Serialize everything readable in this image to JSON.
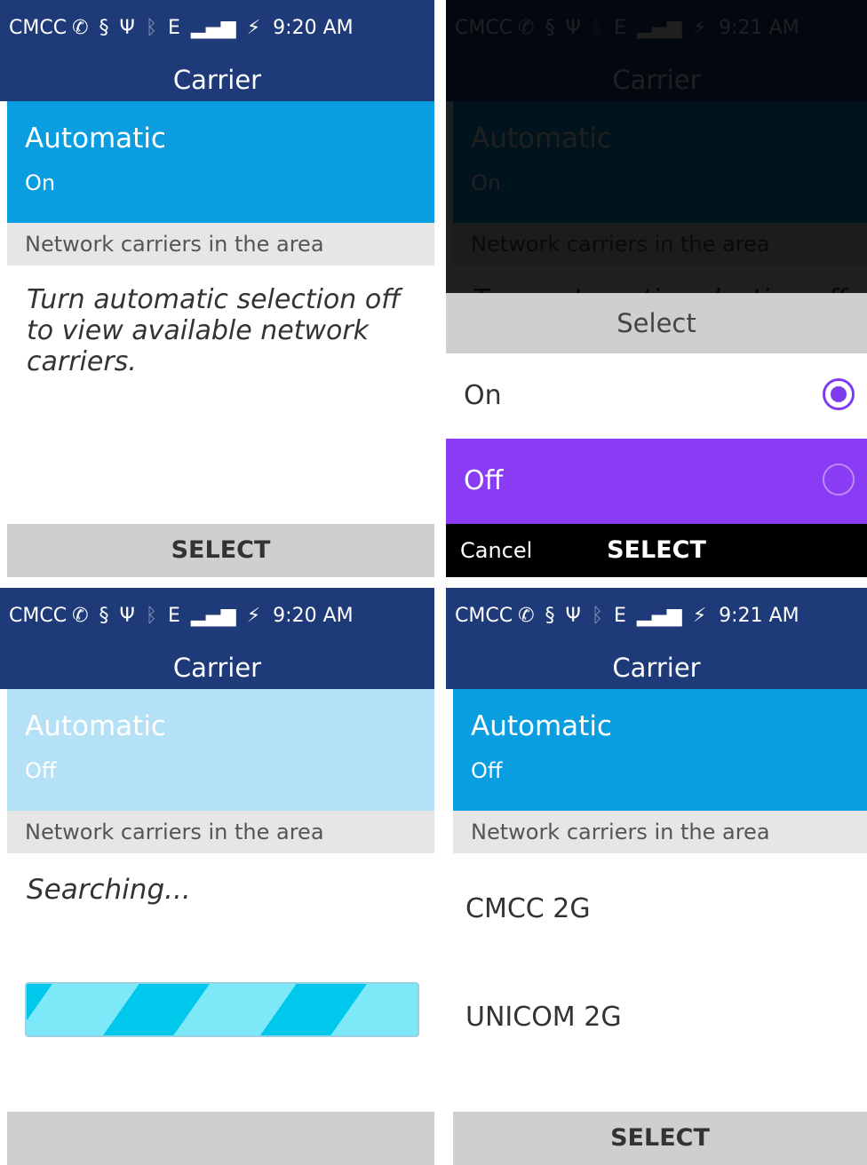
{
  "status": {
    "carrier": "CMCC",
    "network_type": "E",
    "time_a": "9:20 AM",
    "time_b": "9:21 AM",
    "icons": [
      "missed-call-icon",
      "data-sync-icon",
      "usb-icon",
      "bluetooth-icon",
      "signal-icon",
      "battery-charging-icon"
    ]
  },
  "header": {
    "title": "Carrier"
  },
  "automatic": {
    "label": "Automatic",
    "value_on": "On",
    "value_off": "Off"
  },
  "section": {
    "network_header": "Network carriers in the area"
  },
  "hint": "Turn automatic selection off to view available network carriers.",
  "dialog": {
    "title": "Select",
    "options": [
      {
        "label": "On",
        "selected": true
      },
      {
        "label": "Off",
        "selected": false
      }
    ],
    "cancel_label": "Cancel"
  },
  "softkey": {
    "select_label": "SELECT"
  },
  "searching": {
    "text": "Searching..."
  },
  "carriers": [
    "CMCC 2G",
    "UNICOM 2G"
  ],
  "colors": {
    "header_bg": "#1e3a78",
    "accent_blue": "#0a9de0",
    "disabled_blue": "#b4e1f5",
    "dialog_focus": "#8a3cf5",
    "radio_accent": "#7d3cf0"
  }
}
